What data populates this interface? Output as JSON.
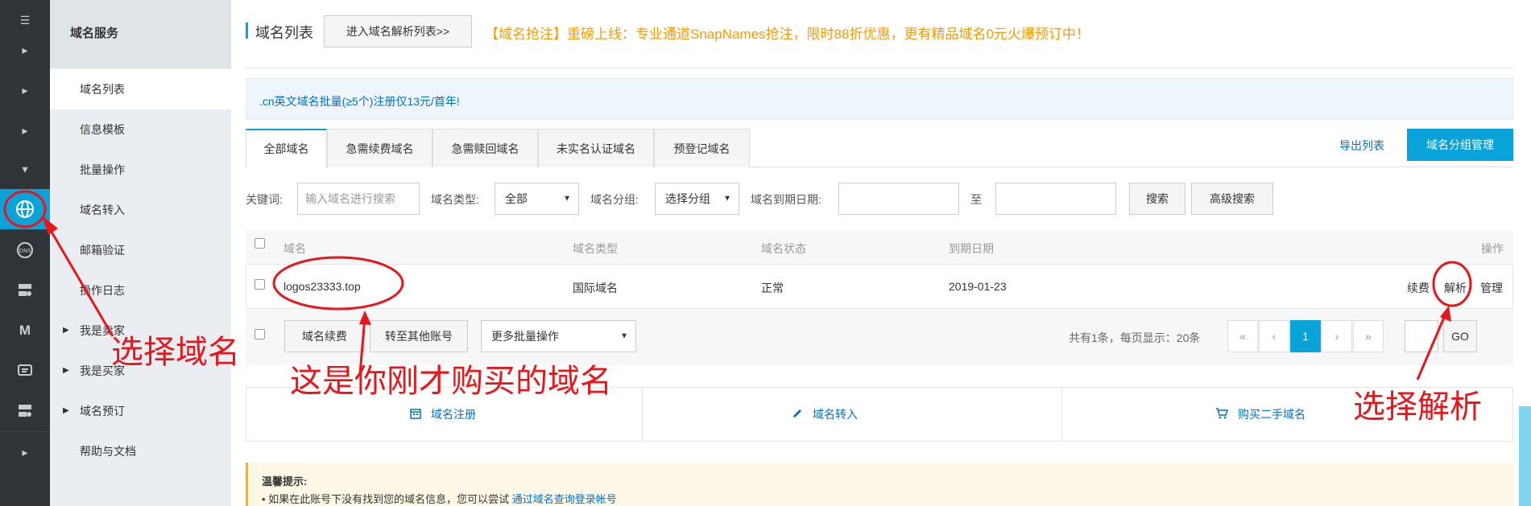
{
  "sidebar": {
    "title": "域名服务",
    "items": [
      {
        "label": "域名列表"
      },
      {
        "label": "信息模板"
      },
      {
        "label": "批量操作"
      },
      {
        "label": "域名转入"
      },
      {
        "label": "邮箱验证"
      },
      {
        "label": "操作日志"
      },
      {
        "label": "我是卖家"
      },
      {
        "label": "我是买家"
      },
      {
        "label": "域名预订"
      },
      {
        "label": "帮助与文档"
      }
    ]
  },
  "header": {
    "title": "域名列表",
    "enter_dns_button": "进入域名解析列表>>",
    "promo": "【域名抢注】重磅上线：专业通道SnapNames抢注，限时88折优惠，更有精品域名0元火爆预订中！"
  },
  "notice": ".cn英文域名批量(≥5个)注册仅13元/首年!",
  "tabs": [
    "全部域名",
    "急需续费域名",
    "急需赎回域名",
    "未实名认证域名",
    "预登记域名"
  ],
  "toolbar": {
    "export": "导出列表",
    "group_manage": "域名分组管理"
  },
  "filters": {
    "keyword_label": "关键词:",
    "keyword_placeholder": "输入域名进行搜索",
    "type_label": "域名类型:",
    "type_value": "全部",
    "group_label": "域名分组:",
    "group_value": "选择分组",
    "expiry_label": "域名到期日期:",
    "to_label": "至",
    "search_button": "搜索",
    "advanced_button": "高级搜索"
  },
  "table": {
    "headers": [
      "域名",
      "域名类型",
      "域名状态",
      "到期日期",
      "操作"
    ],
    "rows": [
      {
        "domain": "logos23333.top",
        "type": "国际域名",
        "status": "正常",
        "expiry": "2019-01-23",
        "actions": [
          "续费",
          "解析",
          "管理"
        ]
      }
    ]
  },
  "bulk": {
    "renew": "域名续费",
    "transfer": "转至其他账号",
    "more": "更多批量操作",
    "summary": "共有1条，每页显示：20条",
    "pager": [
      "«",
      "‹",
      "1",
      "›",
      "»"
    ],
    "go": "GO"
  },
  "quick_links": [
    "域名注册",
    "域名转入",
    "购买二手域名"
  ],
  "tips": {
    "title": "温馨提示:",
    "text": "• 如果在此账号下没有找到您的域名信息，您可以尝试",
    "link": "通过域名查询登录帐号"
  },
  "annotations": {
    "select_domain": "选择域名",
    "purchased_domain": "这是你刚才购买的域名",
    "select_resolve": "选择解析"
  },
  "colors": {
    "accent": "#0aa3d9",
    "link": "#0070cc",
    "promo": "#ff9900",
    "annotation": "#e8161b"
  }
}
